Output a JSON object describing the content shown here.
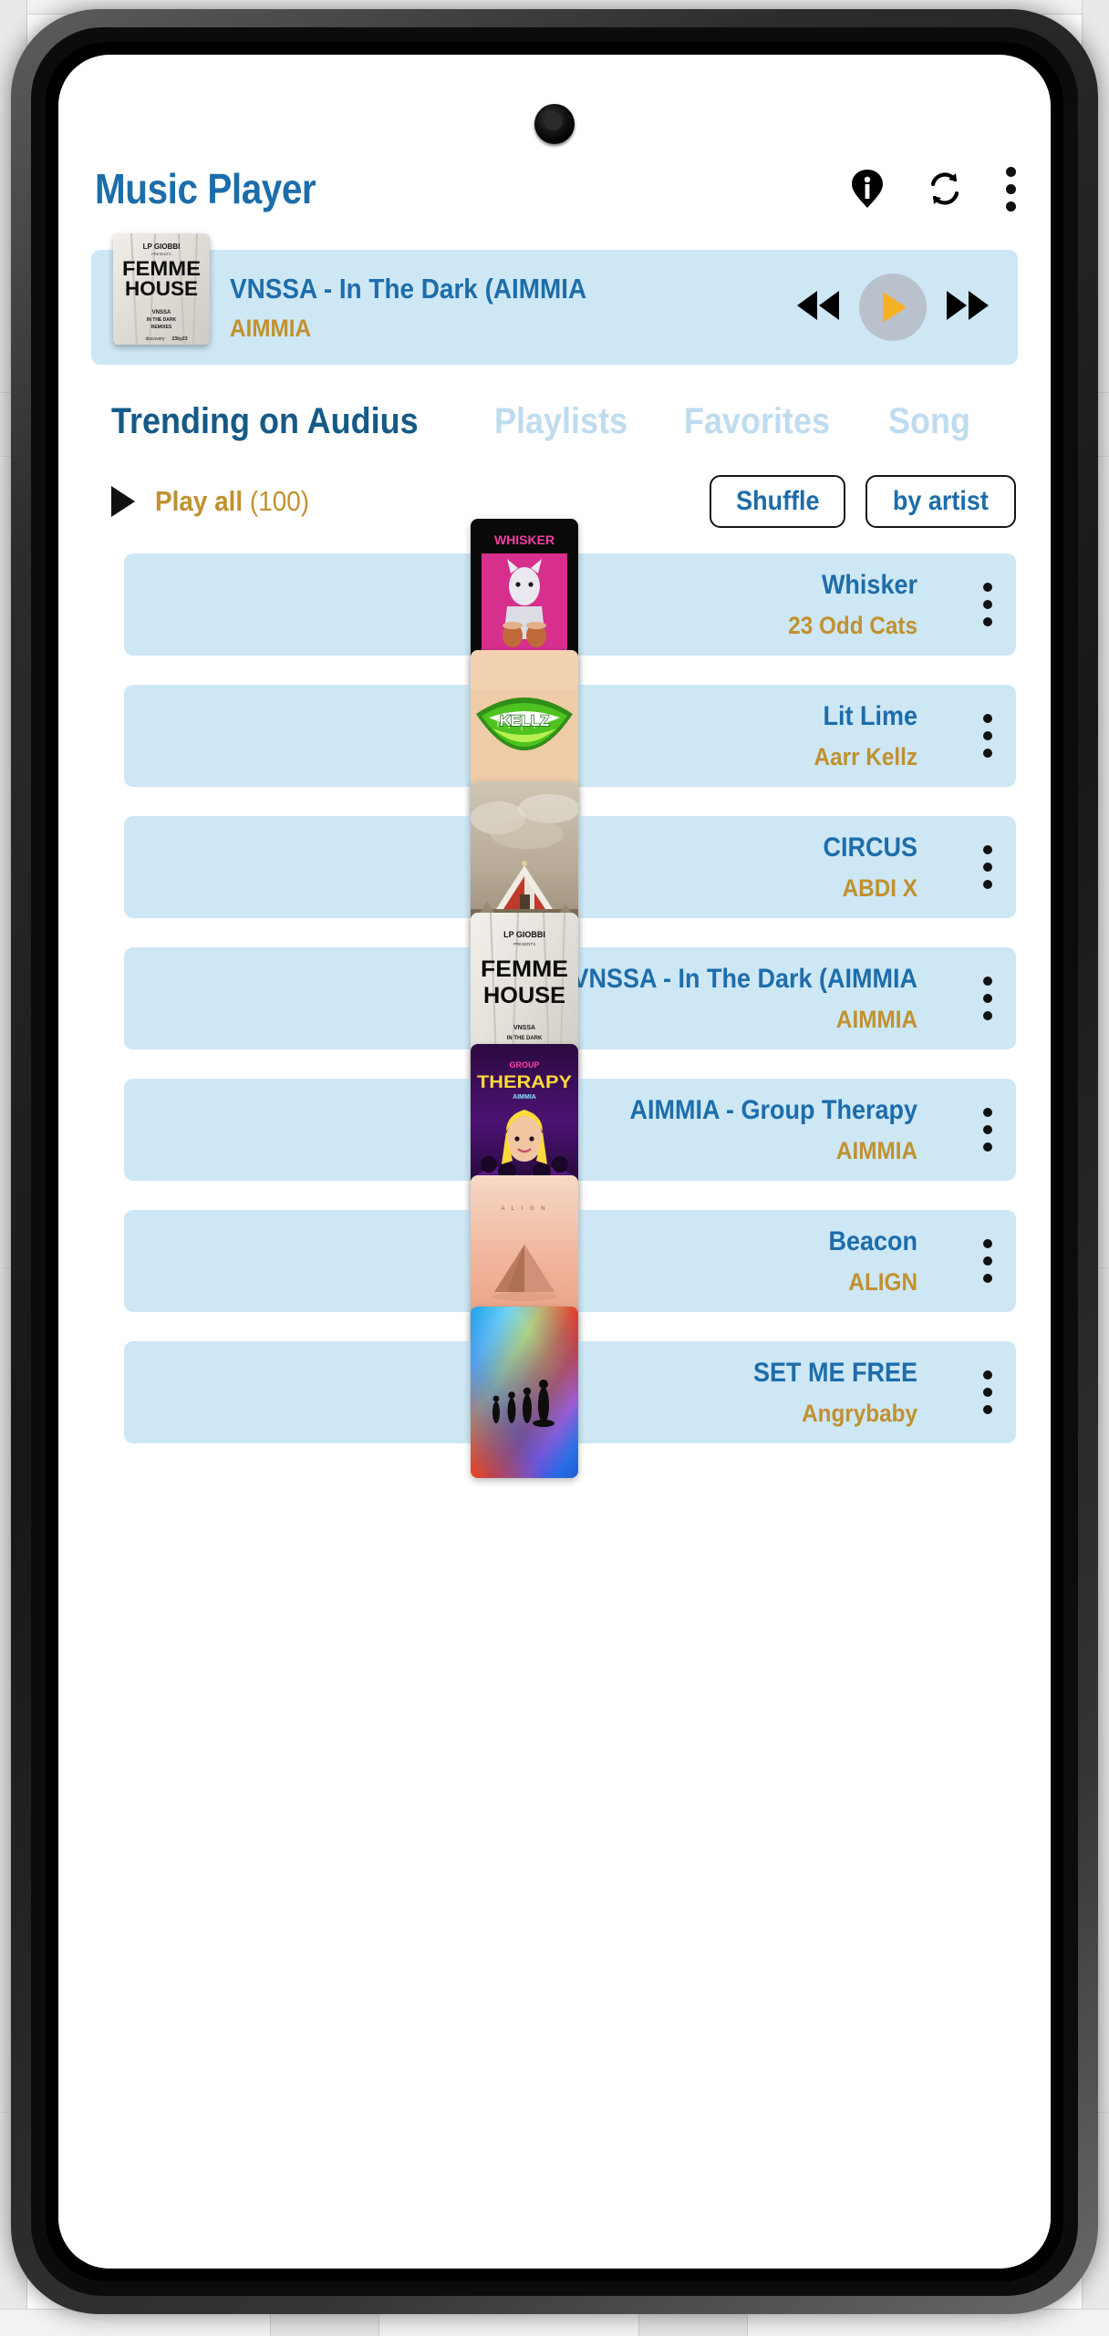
{
  "app": {
    "title": "Music Player",
    "header_icons": [
      {
        "name": "info-pin-icon",
        "label": "Info"
      },
      {
        "name": "refresh-icon",
        "label": "Refresh"
      },
      {
        "name": "overflow-menu-icon",
        "label": "More options"
      }
    ]
  },
  "now_playing": {
    "title": "VNSSA - In The Dark (AIMMIA",
    "artist": "AIMMIA",
    "artwork_name": "femme-house-cover",
    "artwork_text": {
      "presenter": "LP GIOBBI",
      "presents": "PRESENTS",
      "line1": "FEMME",
      "line2": "HOUSE",
      "sub1": "VNSSA",
      "sub2": "IN THE DARK",
      "sub3": "REMIXES",
      "footer1": "discovery",
      "footer2": "23by23"
    },
    "controls": {
      "previous": "previous-track",
      "play": "play",
      "next": "next-track"
    },
    "play_state": "paused"
  },
  "tabs": [
    {
      "label": "Trending on Audius",
      "active": true
    },
    {
      "label": "Playlists",
      "active": false
    },
    {
      "label": "Favorites",
      "active": false
    },
    {
      "label": "Song",
      "active": false
    }
  ],
  "list_controls": {
    "play_all_label": "Play all",
    "play_all_count": "(100)",
    "shuffle_label": "Shuffle",
    "sort_label": "by artist"
  },
  "colors": {
    "accent_blue": "#1d6daa",
    "accent_blue_dark": "#155a87",
    "accent_gold": "#c1912f",
    "row_bg": "#cde7f5",
    "tab_inactive": "#bfdcef",
    "play_button_bg": "#b9c2cc",
    "play_triangle": "#f5b323"
  },
  "tracks": [
    {
      "title": "Whisker",
      "artist": "23 Odd Cats",
      "art": "whisker"
    },
    {
      "title": "Lit Lime",
      "artist": "Aarr Kellz",
      "art": "litlime"
    },
    {
      "title": "CIRCUS",
      "artist": "ABDI X",
      "art": "circus"
    },
    {
      "title": "VNSSA - In The Dark (AIMMIA",
      "artist": "AIMMIA",
      "art": "femme"
    },
    {
      "title": "AIMMIA - Group Therapy",
      "artist": "AIMMIA",
      "art": "therapy"
    },
    {
      "title": "Beacon",
      "artist": "ALIGN",
      "art": "beacon"
    },
    {
      "title": "SET ME FREE",
      "artist": "Angrybaby",
      "art": "setmefree"
    }
  ]
}
